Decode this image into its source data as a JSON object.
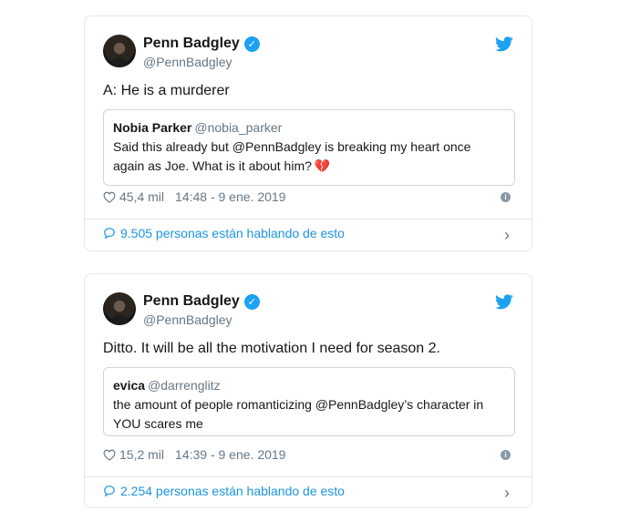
{
  "tweets": [
    {
      "author_name": "Penn Badgley",
      "author_handle": "@PennBadgley",
      "text": "A: He is a murderer",
      "quote": {
        "name": "Nobia Parker",
        "handle": "@nobia_parker",
        "body": "Said this already but @PennBadgley is breaking my heart once again as Joe. What is it about him?",
        "emoji": "💔"
      },
      "likes": "45,4 mil",
      "timestamp": "14:48 - 9 ene. 2019",
      "talking": "9.505 personas están hablando de esto"
    },
    {
      "author_name": "Penn Badgley",
      "author_handle": "@PennBadgley",
      "text": "Ditto. It will be all the motivation I need for season 2.",
      "quote": {
        "name": "evica",
        "handle": "@darrenglitz",
        "body": "the amount of people romanticizing @PennBadgley’s character in YOU scares me"
      },
      "likes": "15,2 mil",
      "timestamp": "14:39 - 9 ene. 2019",
      "talking": "2.254 personas están hablando de esto"
    }
  ],
  "colors": {
    "twitter_blue": "#1da1f2",
    "link_blue": "#1b95e0",
    "muted": "#657786",
    "border": "#e1e8ed"
  },
  "icons": {
    "verified": "verified-badge-icon",
    "logo": "twitter-bird-icon",
    "like": "heart-outline-icon",
    "info": "info-icon",
    "talk": "speech-bubble-icon",
    "chevron": "chevron-right-icon"
  }
}
